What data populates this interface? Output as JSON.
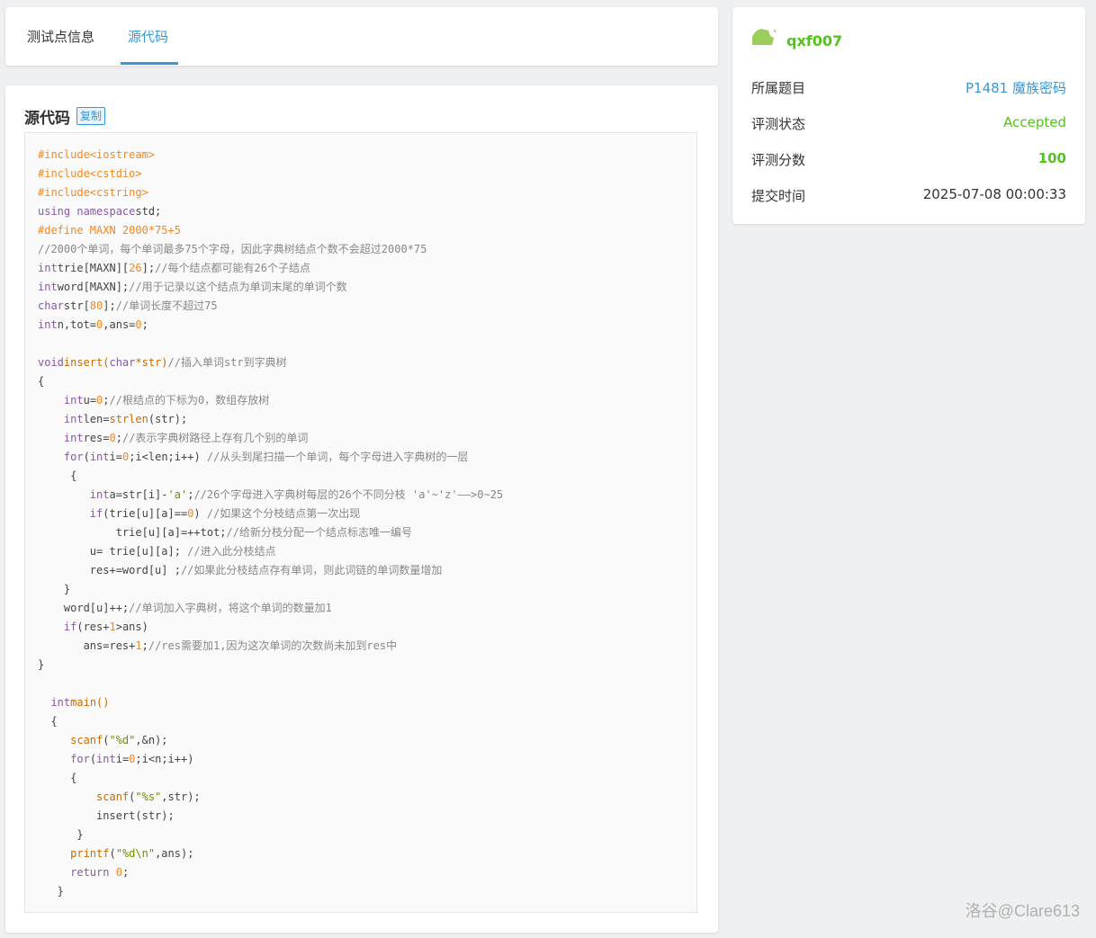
{
  "tabs": {
    "info_label": "测试点信息",
    "source_label": "源代码"
  },
  "code_section": {
    "title": "源代码",
    "copy_label": "复制",
    "lines": [
      [
        [
          "pp",
          "#include<iostream>"
        ]
      ],
      [
        [
          "pp",
          "#include<cstdio>"
        ]
      ],
      [
        [
          "pp",
          "#include<cstring>"
        ]
      ],
      [
        [
          "kw",
          "using namespace"
        ],
        [
          "",
          "std;"
        ]
      ],
      [
        [
          "pp",
          "#define MAXN 2000*75+5"
        ]
      ],
      [
        [
          "cm",
          "//2000个单词，每个单词最多75个字母，因此字典树结点个数不会超过2000*75"
        ]
      ],
      [
        [
          "kw",
          "int"
        ],
        [
          "",
          "trie[MAXN]["
        ],
        [
          "nm",
          "26"
        ],
        [
          "",
          "];"
        ],
        [
          "cm",
          "//每个结点都可能有26个子结点"
        ]
      ],
      [
        [
          "kw",
          "int"
        ],
        [
          "",
          "word[MAXN];"
        ],
        [
          "cm",
          "//用于记录以这个结点为单词末尾的单词个数"
        ]
      ],
      [
        [
          "kw",
          "char"
        ],
        [
          "",
          "str["
        ],
        [
          "nm",
          "80"
        ],
        [
          "",
          "];"
        ],
        [
          "cm",
          "//单词长度不超过75"
        ]
      ],
      [
        [
          "kw",
          "int"
        ],
        [
          "",
          "n,tot="
        ],
        [
          "nm",
          "0"
        ],
        [
          "",
          ",ans="
        ],
        [
          "nm",
          "0"
        ],
        [
          "",
          ";"
        ]
      ],
      [],
      [
        [
          "kw",
          "void"
        ],
        [
          "fn",
          "insert("
        ],
        [
          "kw",
          "char"
        ],
        [
          "fn",
          "*str)"
        ],
        [
          "cm",
          "//插入单词str到字典树"
        ]
      ],
      [
        [
          "",
          "{"
        ]
      ],
      [
        [
          "",
          "    "
        ],
        [
          "kw",
          "int"
        ],
        [
          "",
          "u="
        ],
        [
          "nm",
          "0"
        ],
        [
          "",
          ";"
        ],
        [
          "cm",
          "//根结点的下标为0，数组存放树"
        ]
      ],
      [
        [
          "",
          "    "
        ],
        [
          "kw",
          "int"
        ],
        [
          "",
          "len="
        ],
        [
          "fn",
          "strlen"
        ],
        [
          "",
          "(str);"
        ]
      ],
      [
        [
          "",
          "    "
        ],
        [
          "kw",
          "int"
        ],
        [
          "",
          "res="
        ],
        [
          "nm",
          "0"
        ],
        [
          "",
          ";"
        ],
        [
          "cm",
          "//表示字典树路径上存有几个别的单词"
        ]
      ],
      [
        [
          "",
          "    "
        ],
        [
          "kw",
          "for"
        ],
        [
          "",
          "("
        ],
        [
          "kw",
          "int"
        ],
        [
          "",
          "i="
        ],
        [
          "nm",
          "0"
        ],
        [
          "",
          ";i<len;i++) "
        ],
        [
          "cm",
          "//从头到尾扫描一个单词，每个字母进入字典树的一层"
        ]
      ],
      [
        [
          "",
          "     {"
        ]
      ],
      [
        [
          "",
          "        "
        ],
        [
          "kw",
          "int"
        ],
        [
          "",
          "a=str[i]-"
        ],
        [
          "st",
          "'a'"
        ],
        [
          "",
          ";"
        ],
        [
          "cm",
          "//26个字母进入字典树每层的26个不同分枝 'a'~'z'——>0~25"
        ]
      ],
      [
        [
          "",
          "        "
        ],
        [
          "kw",
          "if"
        ],
        [
          "",
          "(trie[u][a]=="
        ],
        [
          "nm",
          "0"
        ],
        [
          "",
          ") "
        ],
        [
          "cm",
          "//如果这个分枝结点第一次出现"
        ]
      ],
      [
        [
          "",
          "            trie[u][a]=++tot;"
        ],
        [
          "cm",
          "//给新分枝分配一个结点标志唯一编号"
        ]
      ],
      [
        [
          "",
          "        u= trie[u][a]; "
        ],
        [
          "cm",
          "//进入此分枝结点"
        ]
      ],
      [
        [
          "",
          "        res+=word[u] ;"
        ],
        [
          "cm",
          "//如果此分枝结点存有单词，则此词链的单词数量增加"
        ]
      ],
      [
        [
          "",
          "    }"
        ]
      ],
      [
        [
          "",
          "    word[u]++;"
        ],
        [
          "cm",
          "//单词加入字典树，将这个单词的数量加1"
        ]
      ],
      [
        [
          "",
          "    "
        ],
        [
          "kw",
          "if"
        ],
        [
          "",
          "(res+"
        ],
        [
          "nm",
          "1"
        ],
        [
          "",
          ">ans)"
        ]
      ],
      [
        [
          "",
          "       ans=res+"
        ],
        [
          "nm",
          "1"
        ],
        [
          "",
          ";"
        ],
        [
          "cm",
          "//res需要加1,因为这次单词的次数尚未加到res中"
        ]
      ],
      [
        [
          "",
          "}"
        ]
      ],
      [],
      [
        [
          "",
          "  "
        ],
        [
          "kw",
          "int"
        ],
        [
          "fn",
          "main()"
        ]
      ],
      [
        [
          "",
          "  {"
        ]
      ],
      [
        [
          "",
          "     "
        ],
        [
          "fn",
          "scanf"
        ],
        [
          "",
          "("
        ],
        [
          "st",
          "\"%d\""
        ],
        [
          "",
          ",&n);"
        ]
      ],
      [
        [
          "",
          "     "
        ],
        [
          "kw",
          "for"
        ],
        [
          "",
          "("
        ],
        [
          "kw",
          "int"
        ],
        [
          "",
          "i="
        ],
        [
          "nm",
          "0"
        ],
        [
          "",
          ";i<n;i++)"
        ]
      ],
      [
        [
          "",
          "     {"
        ]
      ],
      [
        [
          "",
          "         "
        ],
        [
          "fn",
          "scanf"
        ],
        [
          "",
          "("
        ],
        [
          "st",
          "\"%s\""
        ],
        [
          "",
          ",str);"
        ]
      ],
      [
        [
          "",
          "         insert(str);"
        ]
      ],
      [
        [
          "",
          "      }"
        ]
      ],
      [
        [
          "",
          "     "
        ],
        [
          "fn",
          "printf"
        ],
        [
          "",
          "("
        ],
        [
          "st",
          "\"%d\\n\""
        ],
        [
          "",
          ",ans);"
        ]
      ],
      [
        [
          "",
          "     "
        ],
        [
          "kw",
          "return"
        ],
        [
          "nm",
          " 0"
        ],
        [
          "",
          ";"
        ]
      ],
      [
        [
          "",
          "   }"
        ]
      ]
    ]
  },
  "side": {
    "username": "qxf007",
    "rows": [
      {
        "label": "所属题目",
        "value": "P1481 魔族密码"
      },
      {
        "label": "评测状态",
        "value": "Accepted"
      },
      {
        "label": "评测分数",
        "value": "100"
      },
      {
        "label": "提交时间",
        "value": "2025-07-08 00:00:33"
      }
    ]
  },
  "watermark": "洛谷@Clare613"
}
